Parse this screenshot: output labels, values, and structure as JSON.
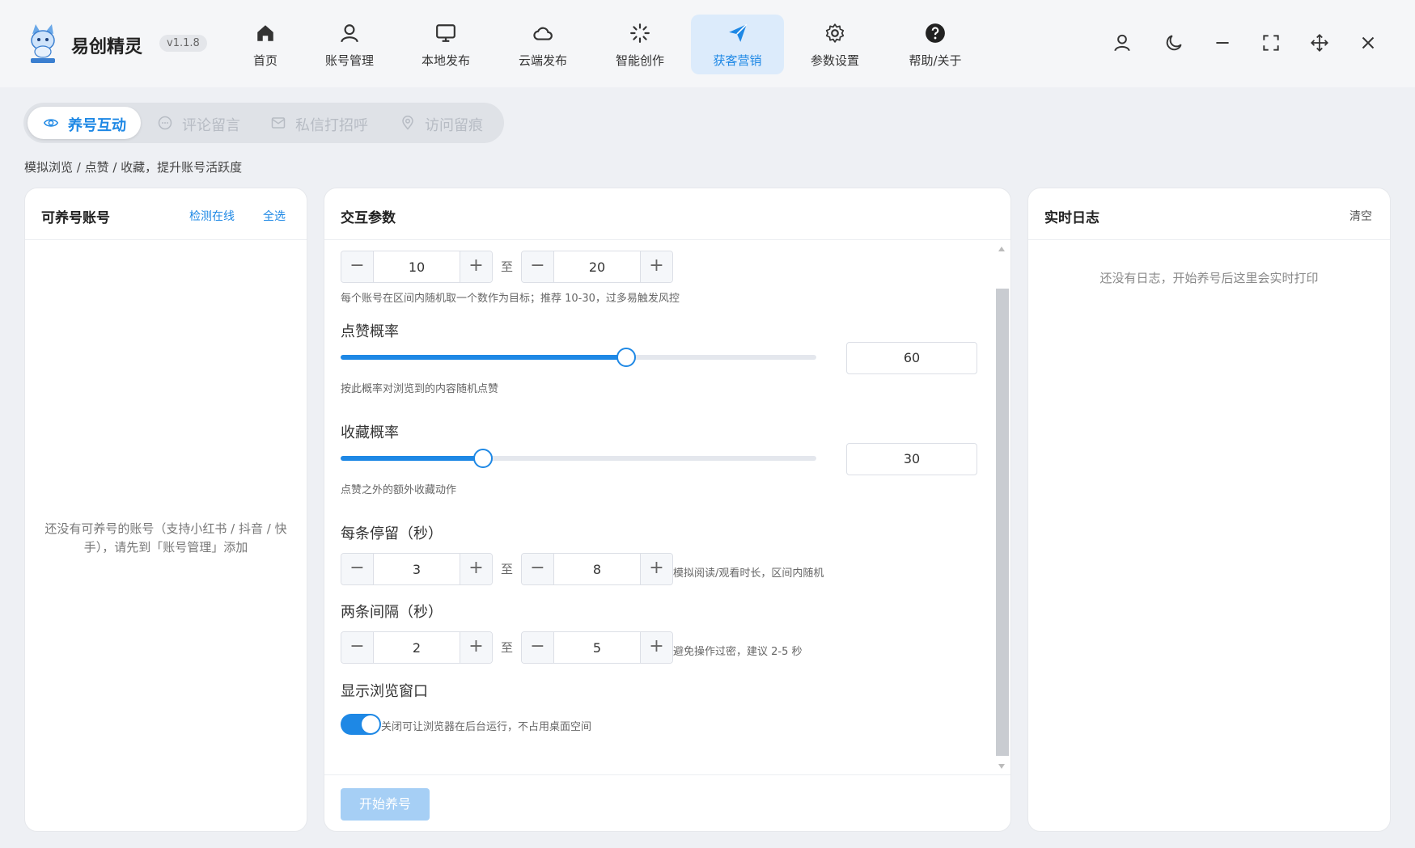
{
  "app": {
    "name": "易创精灵",
    "version": "v1.1.8"
  },
  "nav": [
    {
      "label": "首页",
      "icon": "home-icon"
    },
    {
      "label": "账号管理",
      "icon": "user-icon"
    },
    {
      "label": "本地发布",
      "icon": "monitor-icon"
    },
    {
      "label": "云端发布",
      "icon": "cloud-icon"
    },
    {
      "label": "智能创作",
      "icon": "sparkle-loader-icon"
    },
    {
      "label": "获客营销",
      "icon": "paper-plane-icon",
      "active": true
    },
    {
      "label": "参数设置",
      "icon": "gear-icon"
    },
    {
      "label": "帮助/关于",
      "icon": "help-icon"
    }
  ],
  "tabs": [
    {
      "label": "养号互动",
      "icon": "eye-icon",
      "active": true
    },
    {
      "label": "评论留言",
      "icon": "chat-icon"
    },
    {
      "label": "私信打招呼",
      "icon": "mail-icon"
    },
    {
      "label": "访问留痕",
      "icon": "location-pin-icon"
    }
  ],
  "subtitle": "模拟浏览 / 点赞 / 收藏，提升账号活跃度",
  "accounts_panel": {
    "title": "可养号账号",
    "check_online": "检测在线",
    "select_all": "全选",
    "empty": "还没有可养号的账号（支持小红书 / 抖音 / 快手），请先到「账号管理」添加"
  },
  "params_panel": {
    "title": "交互参数",
    "browse_count": {
      "min": "10",
      "max": "20",
      "to": "至",
      "hint": "每个账号在区间内随机取一个数作为目标；推荐 10-30，过多易触发风控"
    },
    "like_rate": {
      "label": "点赞概率",
      "value": "60",
      "percent": 60,
      "hint": "按此概率对浏览到的内容随机点赞"
    },
    "fav_rate": {
      "label": "收藏概率",
      "value": "30",
      "percent": 30,
      "hint": "点赞之外的额外收藏动作"
    },
    "stay": {
      "label": "每条停留（秒）",
      "min": "3",
      "max": "8",
      "to": "至",
      "hint": "模拟阅读/观看时长，区间内随机"
    },
    "interval": {
      "label": "两条间隔（秒）",
      "min": "2",
      "max": "5",
      "to": "至",
      "hint": "避免操作过密，建议 2-5 秒"
    },
    "show_browser": {
      "label": "显示浏览窗口",
      "enabled": true,
      "hint": "关闭可让浏览器在后台运行，不占用桌面空间"
    },
    "start_button": "开始养号",
    "stepper_minus": "−",
    "stepper_plus": "+"
  },
  "log_panel": {
    "title": "实时日志",
    "clear": "清空",
    "empty": "还没有日志，开始养号后这里会实时打印"
  },
  "colors": {
    "accent": "#1e88e5",
    "accent_light": "#dcebfb",
    "button_disabled": "#a6cff5"
  }
}
